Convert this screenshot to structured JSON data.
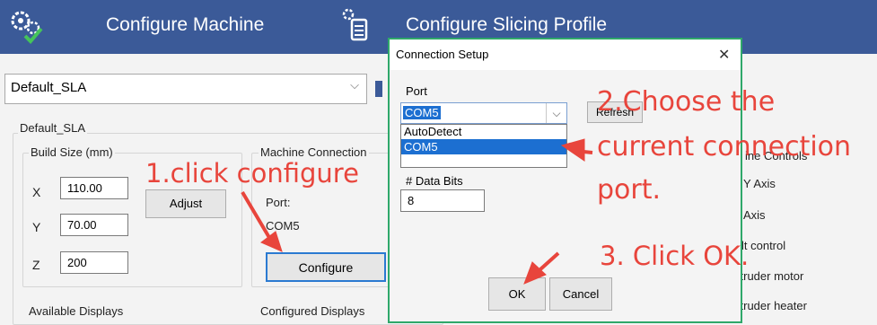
{
  "header": {
    "configure_machine": "Configure Machine",
    "configure_slicing": "Configure Slicing Profile",
    "gear_icon": "gear-check-icon",
    "document_icon": "document-gear-icon"
  },
  "profile_select": {
    "value": "Default_SLA",
    "arrow": "⌵"
  },
  "profile_group": "Default_SLA",
  "build_size": {
    "title": "Build Size (mm)",
    "x_label": "X",
    "x_value": "110.00",
    "y_label": "Y",
    "y_value": "70.00",
    "z_label": "Z",
    "z_value": "200",
    "adjust": "Adjust"
  },
  "machine_connection": {
    "title": "Machine Connection",
    "port_label": "Port:",
    "port_value": "COM5",
    "configure": "Configure"
  },
  "available_displays": "Available Displays",
  "configured_displays": "Configured Displays",
  "right_partial": {
    "controls": "ine Controls",
    "y_axis": "Y Axis",
    "axis": "Axis",
    "tilt": "lt control",
    "extruder_motor": "xtruder motor",
    "extruder_heater": "xtruder heater"
  },
  "dialog": {
    "title": "Connection Setup",
    "close": "✕",
    "port_label": "Port",
    "port_value": "COM5",
    "refresh": "Refresh",
    "options": [
      "AutoDetect",
      "COM5"
    ],
    "data_bits_label": "# Data Bits",
    "data_bits_value": "8",
    "ok": "OK",
    "cancel": "Cancel"
  },
  "annotations": {
    "step1": "1.click configure",
    "step2_line1": "2.Choose the",
    "step2_line2": "current connection",
    "step2_line3": "port.",
    "step3": "3. Click OK."
  },
  "colors": {
    "header": "#3b5a98",
    "dialog_border": "#2fa86a",
    "selection": "#1c6fd1",
    "annotation": "#e8453c"
  }
}
